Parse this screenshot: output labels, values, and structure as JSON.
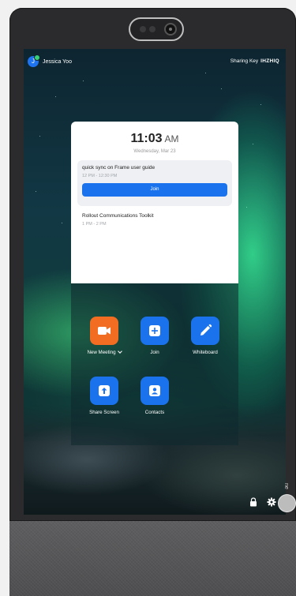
{
  "header": {
    "user_initial": "J",
    "user_name": "Jessica Yoo",
    "sharing_label": "Sharing Key",
    "sharing_key": "IHZHIQ"
  },
  "clock": {
    "time": "11:03",
    "ampm": "AM",
    "date": "Wednesday, Mar 23"
  },
  "meetings": [
    {
      "title": "quick sync on Frame user guide",
      "time": "12 PM - 12:30 PM",
      "action": "Join"
    },
    {
      "title": "Rollout Communications Toolkit",
      "time": "1 PM - 2 PM"
    }
  ],
  "actions": [
    {
      "label": "New Meeting",
      "icon": "video-camera-icon",
      "color": "#F26D21"
    },
    {
      "label": "Join",
      "icon": "plus-icon",
      "color": "#1A73EC"
    },
    {
      "label": "Whiteboard",
      "icon": "pencil-icon",
      "color": "#1A73EC"
    },
    {
      "label": "Share Screen",
      "icon": "share-up-icon",
      "color": "#1A73EC"
    },
    {
      "label": "Contacts",
      "icon": "contact-icon",
      "color": "#1A73EC"
    }
  ],
  "footer": {
    "lock_icon": "lock-icon",
    "settings_icon": "gear-icon",
    "side_label": "ne"
  },
  "colors": {
    "accent": "#1A73EC",
    "orange": "#F26D21",
    "presence": "#3AD07A"
  }
}
